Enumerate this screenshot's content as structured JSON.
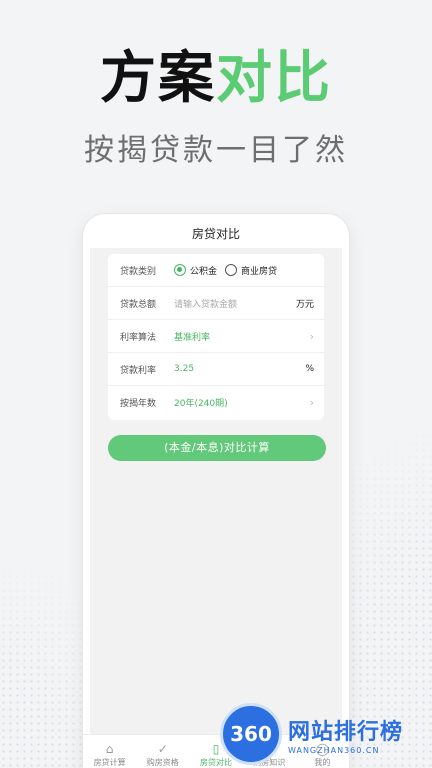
{
  "hero": {
    "title_dark": "方案",
    "title_green": "对比",
    "subtitle": "按揭贷款一目了然"
  },
  "app": {
    "nav_title": "房贷对比",
    "form": {
      "loan_type_label": "贷款类别",
      "loan_type_options": [
        "公积金",
        "商业房贷"
      ],
      "loan_type_selected": "公积金",
      "amount_label": "贷款总额",
      "amount_placeholder": "请输入贷款金额",
      "amount_unit": "万元",
      "rate_method_label": "利率算法",
      "rate_method_value": "基准利率",
      "rate_label": "贷款利率",
      "rate_value": "3.25",
      "rate_unit": "%",
      "term_label": "按揭年数",
      "term_value": "20年(240期)"
    },
    "calc_button": "(本金/本息)对比计算",
    "tabs": [
      {
        "label": "房贷计算",
        "icon": "house-calc-icon"
      },
      {
        "label": "购房资格",
        "icon": "check-circle-icon"
      },
      {
        "label": "房贷对比",
        "icon": "book-compare-icon",
        "active": true
      },
      {
        "label": "购房知识",
        "icon": "document-icon"
      },
      {
        "label": "我的",
        "icon": "user-icon"
      }
    ]
  },
  "watermark": {
    "logo_text": "360",
    "cn_text": "网站排行榜",
    "en_text": "WANGZHAN360.CN"
  },
  "colors": {
    "accent_green": "#5ccc74",
    "button_green": "#62c97a",
    "watermark_blue": "#2c6fe0"
  }
}
